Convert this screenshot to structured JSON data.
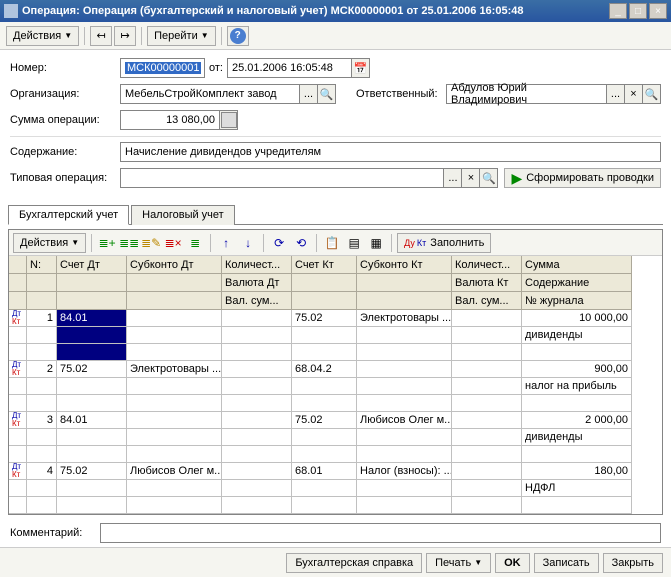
{
  "titlebar": {
    "title": "Операция: Операция (бухгалтерский и налоговый учет) МСК00000001 от 25.01.2006 16:05:48"
  },
  "toolbar": {
    "actions": "Действия",
    "goto": "Перейти"
  },
  "form": {
    "number_label": "Номер:",
    "number_value": "МСК00000001",
    "ot_label": "от:",
    "date_value": "25.01.2006 16:05:48",
    "org_label": "Организация:",
    "org_value": "МебельСтройКомплект завод",
    "resp_label": "Ответственный:",
    "resp_value": "Абдулов Юрий Владимирович",
    "sum_label": "Сумма операции:",
    "sum_value": "13 080,00",
    "content_label": "Содержание:",
    "content_value": "Начисление дивидендов учредителям",
    "typop_label": "Типовая операция:",
    "typop_value": "",
    "form_btn": "Сформировать проводки"
  },
  "tabs": {
    "t1": "Бухгалтерский учет",
    "t2": "Налоговый учет"
  },
  "grid_toolbar": {
    "actions": "Действия",
    "fill": "Заполнить"
  },
  "grid": {
    "headers": {
      "n": "N:",
      "schet_dt": "Счет Дт",
      "subkonto_dt": "Субконто Дт",
      "kolich": "Количест...",
      "valuta_dt": "Валюта Дт",
      "valsum": "Вал. сум...",
      "schet_kt": "Счет Кт",
      "subkonto_kt": "Субконто Кт",
      "kolich2": "Количест...",
      "valuta_kt": "Валюта Кт",
      "valsum2": "Вал. сум...",
      "summa": "Сумма",
      "soderzh": "Содержание",
      "njour": "№ журнала"
    },
    "rows": [
      {
        "n": "1",
        "dt": "84.01",
        "sub_dt": "",
        "kt": "75.02",
        "sub_kt": "Электротовары ...",
        "sum": "10 000,00",
        "desc": "дивиденды"
      },
      {
        "n": "2",
        "dt": "75.02",
        "sub_dt": "Электротовары ...",
        "kt": "68.04.2",
        "sub_kt": "",
        "sum": "900,00",
        "desc": "налог на прибыль"
      },
      {
        "n": "3",
        "dt": "84.01",
        "sub_dt": "",
        "kt": "75.02",
        "sub_kt": "Любисов Олег м...",
        "sum": "2 000,00",
        "desc": "дивиденды"
      },
      {
        "n": "4",
        "dt": "75.02",
        "sub_dt": "Любисов Олег м...",
        "kt": "68.01",
        "sub_kt": "Налог (взносы): ...",
        "sum": "180,00",
        "desc": "НДФЛ"
      }
    ]
  },
  "footer": {
    "comment_label": "Комментарий:",
    "comment_value": ""
  },
  "bottom": {
    "buh_sprav": "Бухгалтерская справка",
    "print": "Печать",
    "ok": "OK",
    "save": "Записать",
    "close": "Закрыть"
  }
}
